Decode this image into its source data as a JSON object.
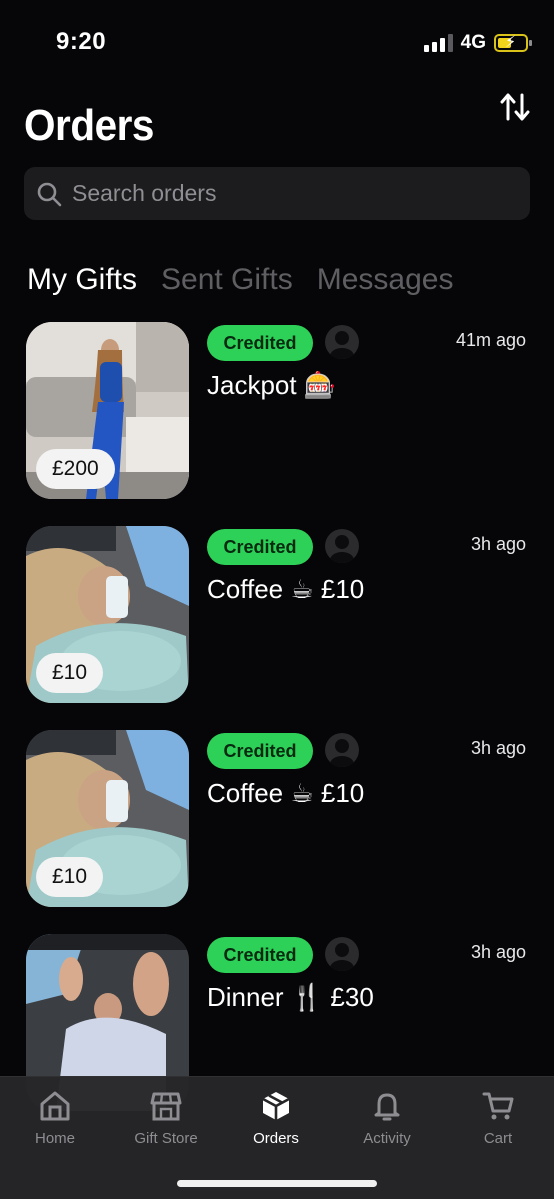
{
  "status_bar": {
    "time": "9:20",
    "network": "4G"
  },
  "header": {
    "title": "Orders"
  },
  "search": {
    "placeholder": "Search orders"
  },
  "tabs": [
    {
      "label": "My Gifts",
      "active": true
    },
    {
      "label": "Sent Gifts",
      "active": false
    },
    {
      "label": "Messages",
      "active": false
    }
  ],
  "orders": [
    {
      "status": "Credited",
      "title": "Jackpot 🎰",
      "time": "41m ago",
      "price": "£200"
    },
    {
      "status": "Credited",
      "title": "Coffee ☕ £10",
      "time": "3h ago",
      "price": "£10"
    },
    {
      "status": "Credited",
      "title": "Coffee ☕ £10",
      "time": "3h ago",
      "price": "£10"
    },
    {
      "status": "Credited",
      "title": "Dinner 🍴 £30",
      "time": "3h ago",
      "price": ""
    }
  ],
  "bottom_nav": [
    {
      "label": "Home",
      "icon": "home-icon",
      "active": false
    },
    {
      "label": "Gift Store",
      "icon": "store-icon",
      "active": false
    },
    {
      "label": "Orders",
      "icon": "box-icon",
      "active": true
    },
    {
      "label": "Activity",
      "icon": "bell-icon",
      "active": false
    },
    {
      "label": "Cart",
      "icon": "cart-icon",
      "active": false
    }
  ],
  "colors": {
    "badge_green": "#2ed158",
    "background": "#060608",
    "tab_bar": "#262628"
  }
}
